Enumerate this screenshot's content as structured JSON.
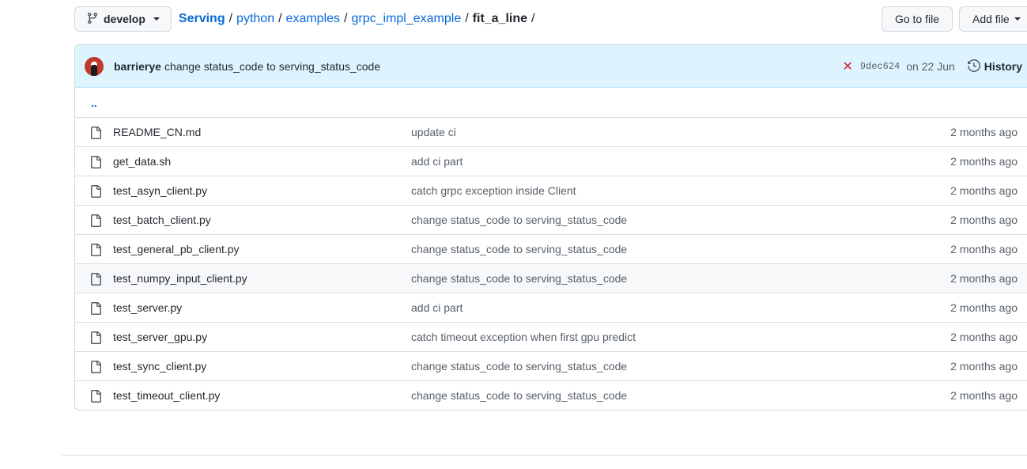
{
  "branch": {
    "name": "develop"
  },
  "breadcrumb": {
    "repo": "Serving",
    "parts": [
      "python",
      "examples",
      "grpc_impl_example"
    ],
    "current": "fit_a_line",
    "separator": "/"
  },
  "actions": {
    "go_to_file": "Go to file",
    "add_file": "Add file"
  },
  "commit": {
    "author": "barrierye",
    "message": "change status_code to serving_status_code",
    "status_icon": "✕",
    "sha": "9dec624",
    "date": "on 22 Jun",
    "history_label": "History"
  },
  "parent_dir": "..",
  "files": [
    {
      "name": "README_CN.md",
      "message": "update ci",
      "age": "2 months ago"
    },
    {
      "name": "get_data.sh",
      "message": "add ci part",
      "age": "2 months ago"
    },
    {
      "name": "test_asyn_client.py",
      "message": "catch grpc exception inside Client",
      "age": "2 months ago"
    },
    {
      "name": "test_batch_client.py",
      "message": "change status_code to serving_status_code",
      "age": "2 months ago"
    },
    {
      "name": "test_general_pb_client.py",
      "message": "change status_code to serving_status_code",
      "age": "2 months ago"
    },
    {
      "name": "test_numpy_input_client.py",
      "message": "change status_code to serving_status_code",
      "age": "2 months ago"
    },
    {
      "name": "test_server.py",
      "message": "add ci part",
      "age": "2 months ago"
    },
    {
      "name": "test_server_gpu.py",
      "message": "catch timeout exception when first gpu predict",
      "age": "2 months ago"
    },
    {
      "name": "test_sync_client.py",
      "message": "change status_code to serving_status_code",
      "age": "2 months ago"
    },
    {
      "name": "test_timeout_client.py",
      "message": "change status_code to serving_status_code",
      "age": "2 months ago"
    }
  ]
}
